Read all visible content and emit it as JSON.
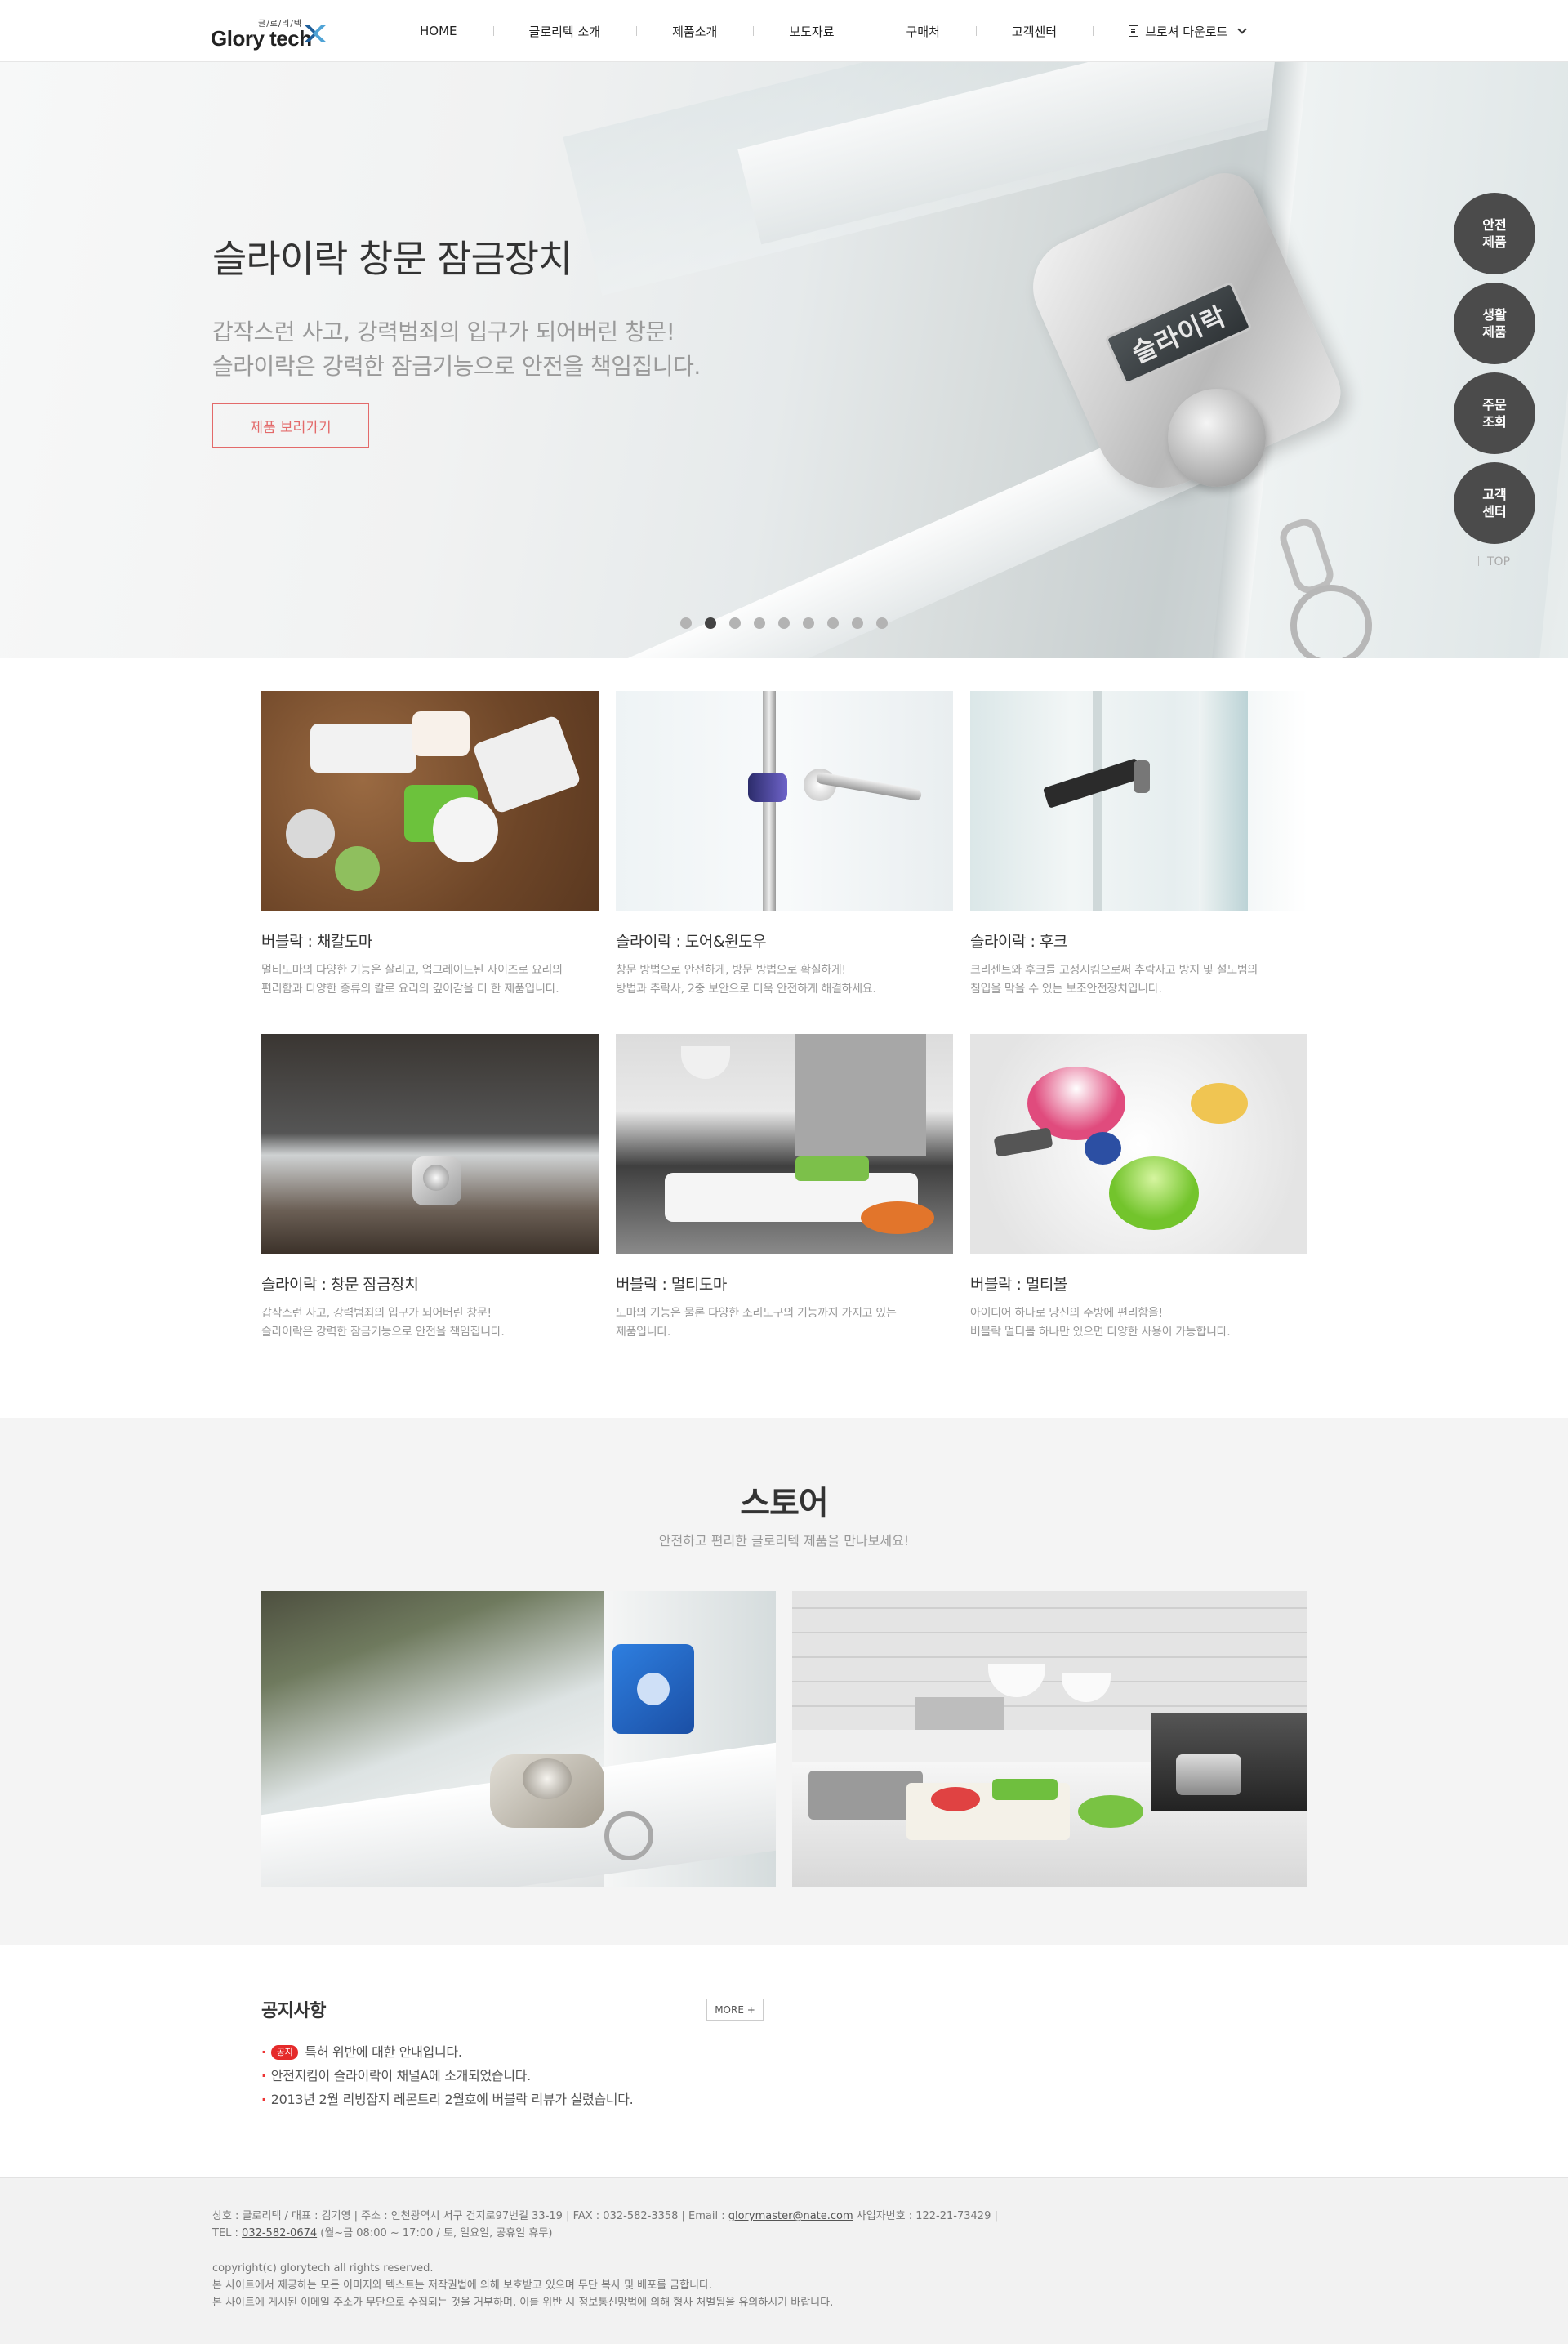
{
  "header": {
    "logo_small": "글/로/리/텍",
    "logo_text": "Glory tech",
    "nav": [
      "HOME",
      "글로리텍 소개",
      "제품소개",
      "보도자료",
      "구매처",
      "고객센터"
    ],
    "download_label": "브로셔 다운로드"
  },
  "hero": {
    "title": "슬라이락 창문 잠금장치",
    "sub_line1": "갑작스런 사고, 강력범죄의 입구가 되어버린 창문!",
    "sub_line2": "슬라이락은 강력한 잠금기능으로 안전을 책임집니다.",
    "button": "제품 보러가기",
    "lock_label": "슬라이락",
    "slide_count": 9,
    "active_slide": 2
  },
  "quick_menu": {
    "items": [
      "안전\n제품",
      "생활\n제품",
      "주문\n조회",
      "고객\n센터"
    ],
    "top": "TOP"
  },
  "products": [
    {
      "title": "버블락 : 채칼도마",
      "desc": "멀티도마의 다양한 기능은 살리고, 업그레이드된 사이즈로 요리의\n편리함과 다양한 종류의 칼로 요리의 깊이감을 더 한 제품입니다."
    },
    {
      "title": "슬라이락 : 도어&윈도우",
      "desc": "창문 방법으로 안전하게, 방문 방법으로 확실하게!\n방법과 추락사, 2중 보안으로 더욱 안전하게 해결하세요."
    },
    {
      "title": "슬라이락 : 후크",
      "desc": "크리센트와 후크를 고정시킴으로써 추락사고 방지 및 설도범의\n침입을 막을 수 있는 보조안전장치입니다."
    },
    {
      "title": "슬라이락 : 창문 잠금장치",
      "desc": "갑작스런 사고, 강력범죄의 입구가 되어버린 창문!\n슬라이락은 강력한 잠금기능으로 안전을 책임집니다."
    },
    {
      "title": "버블락 : 멀티도마",
      "desc": "도마의 기능은 물론 다양한 조리도구의 기능까지 가지고 있는\n제품입니다."
    },
    {
      "title": "버블락 : 멀티볼",
      "desc": "아이디어 하나로 당신의 주방에 편리함을!\n버블락 멀티볼 하나만 있으면 다양한 사용이 가능합니다."
    }
  ],
  "store": {
    "title": "스토어",
    "subtitle": "안전하고 편리한 글로리텍 제품을 만나보세요!"
  },
  "notice": {
    "title": "공지사항",
    "more": "MORE +",
    "badge": "공지",
    "items": [
      "특허 위반에 대한 안내입니다.",
      "안전지킴이 슬라이락이 채널A에 소개되었습니다.",
      "2013년 2월 리빙잡지 레몬트리 2월호에 버블락 리뷰가 실렸습니다."
    ]
  },
  "footer": {
    "line1_pre": "상호 : 글로리텍 / 대표 : 김기영 | 주소 : 인천광역시 서구 건지로97번길 33-19 | FAX : 032-582-3358 | Email : ",
    "email": "glorymaster@nate.com",
    "line1_post": " 사업자번호 : 122-21-73429 |",
    "tel_pre": "TEL : ",
    "tel": "032-582-0674",
    "tel_post": " (월~금 08:00 ~ 17:00 / 토, 일요일, 공휴일 휴무)",
    "copyright": "copyright(c) glorytech all rights reserved.",
    "notice1": "본 사이트에서 제공하는 모든 이미지와 텍스트는 저작권법에 의해 보호받고 있으며 무단 복사 및 배포를 금합니다.",
    "notice2": "본 사이트에 게시된 이메일 주소가 무단으로 수집되는 것을 거부하며, 이를 위반 시 정보통신망법에 의해 형사 처벌됨을 유의하시기 바랍니다."
  },
  "colors": {
    "accent": "#e36a6a",
    "quick_bg": "#4b4b4b",
    "badge": "#e52b2b"
  }
}
